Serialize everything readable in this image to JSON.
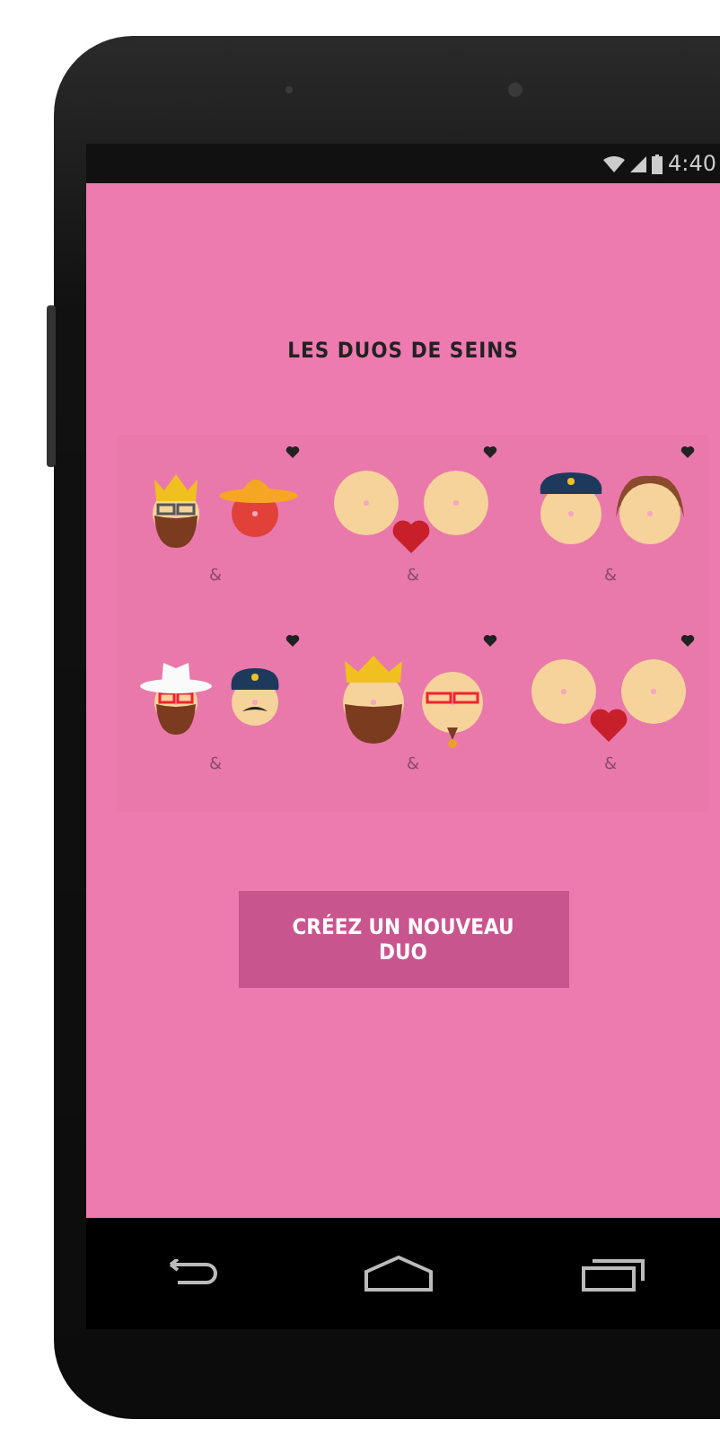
{
  "status_bar": {
    "time": "4:40"
  },
  "title": "LES DUOS DE SEINS",
  "duos": [
    {
      "kind": "king-and-sunhat",
      "separator": "&"
    },
    {
      "kind": "breasts-heart",
      "separator": "&"
    },
    {
      "kind": "police-and-hair",
      "separator": "&"
    },
    {
      "kind": "cowboy-and-police",
      "separator": "&"
    },
    {
      "kind": "crown-and-glasses",
      "separator": "&"
    },
    {
      "kind": "breasts-heart",
      "separator": "&"
    }
  ],
  "create_button": "CRÉEZ UN NOUVEAU DUO"
}
